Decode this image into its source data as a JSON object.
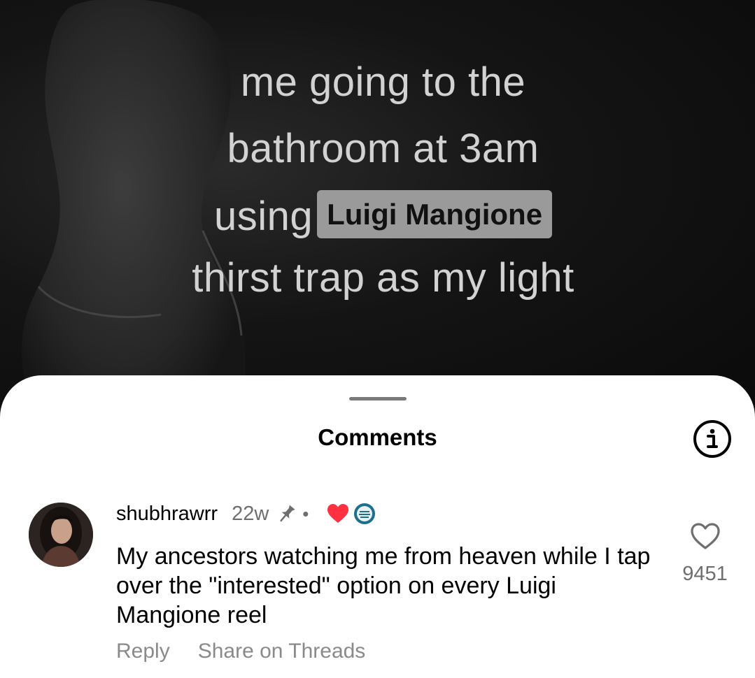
{
  "video": {
    "caption_lines": {
      "line1": "me going to the",
      "line2": "bathroom at 3am",
      "line3_prefix": "using",
      "line3_highlight": "Luigi Mangione",
      "line4": "thirst trap as my light"
    }
  },
  "comments_sheet": {
    "title": "Comments",
    "info_icon": "info-circle-icon",
    "comment": {
      "username": "shubhrawrr",
      "time": "22w",
      "pinned_icon": "pin-icon",
      "separator": "•",
      "liked_by_creator_icon": "heart-filled-icon",
      "text": "My ancestors watching me from heaven while I tap over the \"interested\" option on every Luigi Mangione reel",
      "like_icon": "heart-outline-icon",
      "like_count": "9451",
      "actions": {
        "reply": "Reply",
        "share": "Share on Threads"
      }
    }
  },
  "colors": {
    "accent_red": "#ff3040",
    "muted_text": "#6e6e6e",
    "highlight_bg": "#9a9a9a"
  }
}
